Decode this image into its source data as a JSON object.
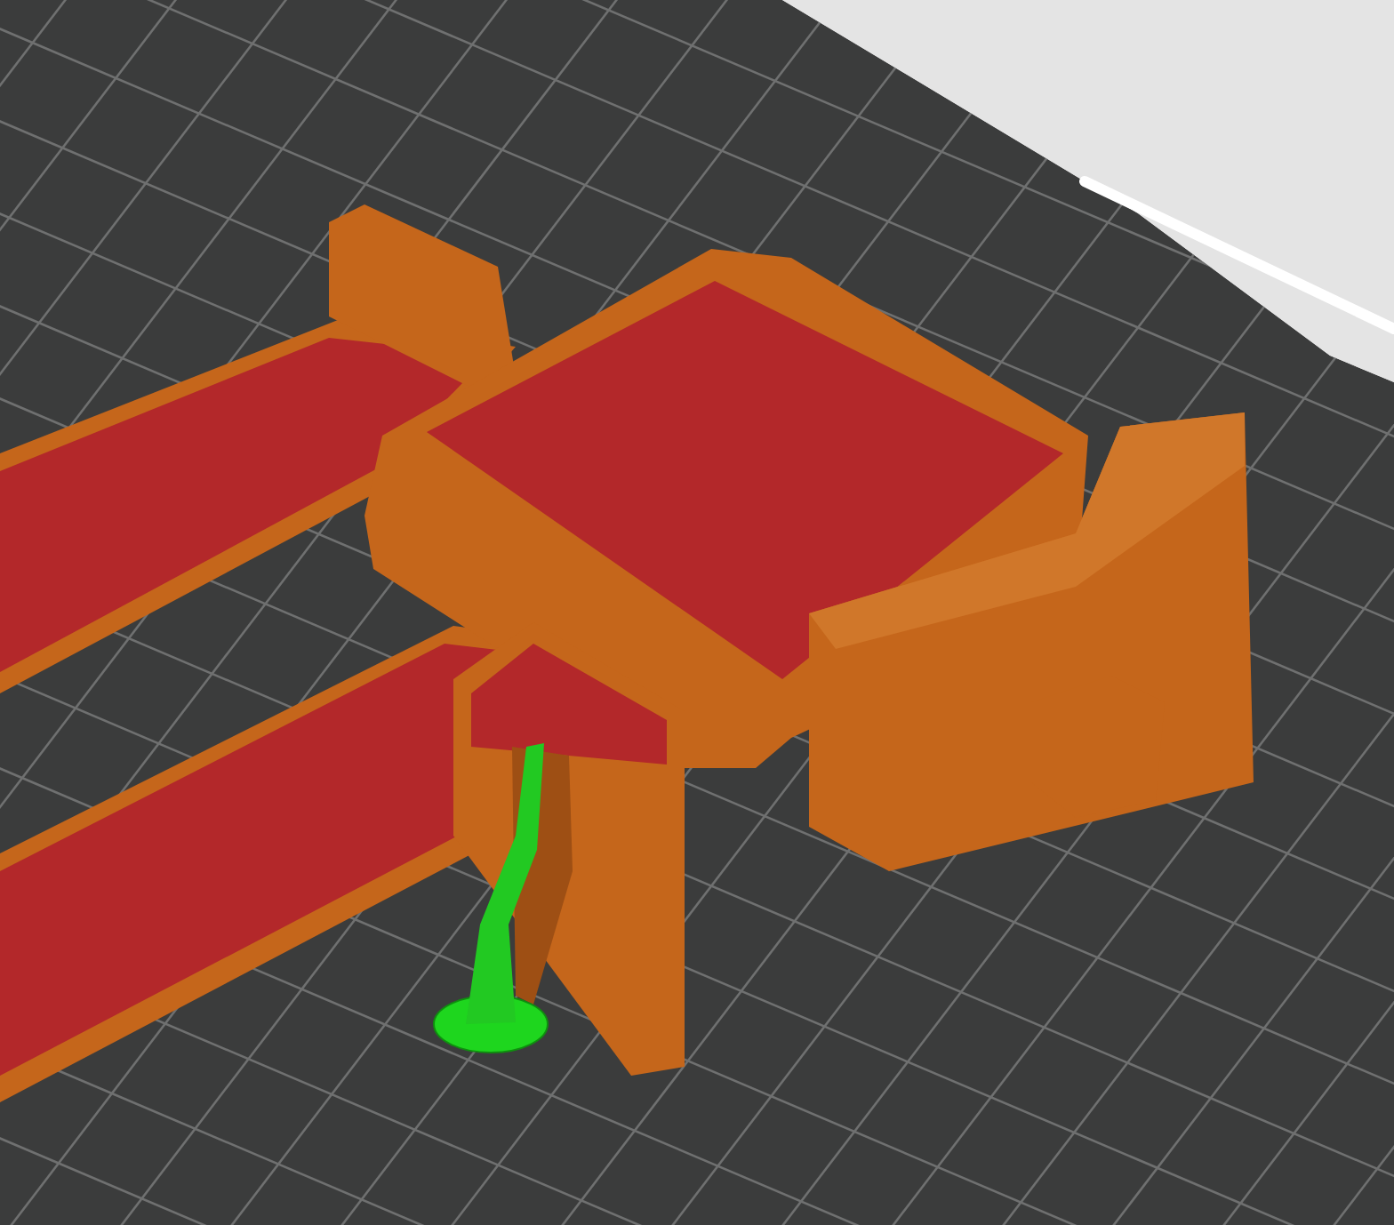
{
  "scene": {
    "kind": "slice-preview",
    "objects": [
      {
        "kind": "model"
      },
      {
        "kind": "support"
      }
    ]
  }
}
